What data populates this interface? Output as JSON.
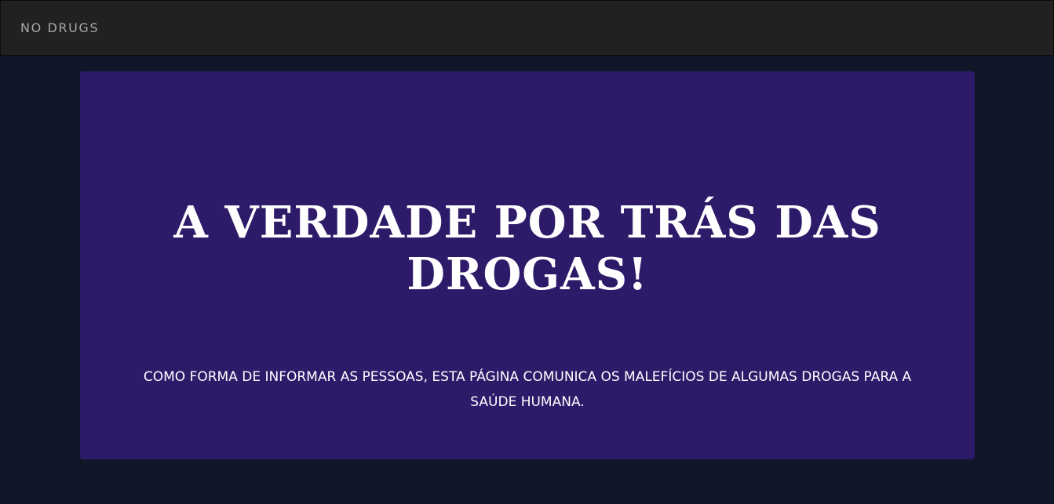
{
  "navbar": {
    "brand": "NO DRUGS"
  },
  "hero": {
    "title": "A VERDADE POR TRÁS DAS DROGAS!",
    "description": "COMO FORMA DE INFORMAR AS PESSOAS, ESTA PÁGINA COMUNICA OS MALEFÍCIOS DE ALGUMAS DROGAS PARA A SAÚDE HUMANA."
  },
  "colors": {
    "page_background": "#111628",
    "navbar_background": "#212121",
    "brand_text": "#a9a9a9",
    "hero_background": "#2d1b6a",
    "hero_text": "#ffffff"
  }
}
